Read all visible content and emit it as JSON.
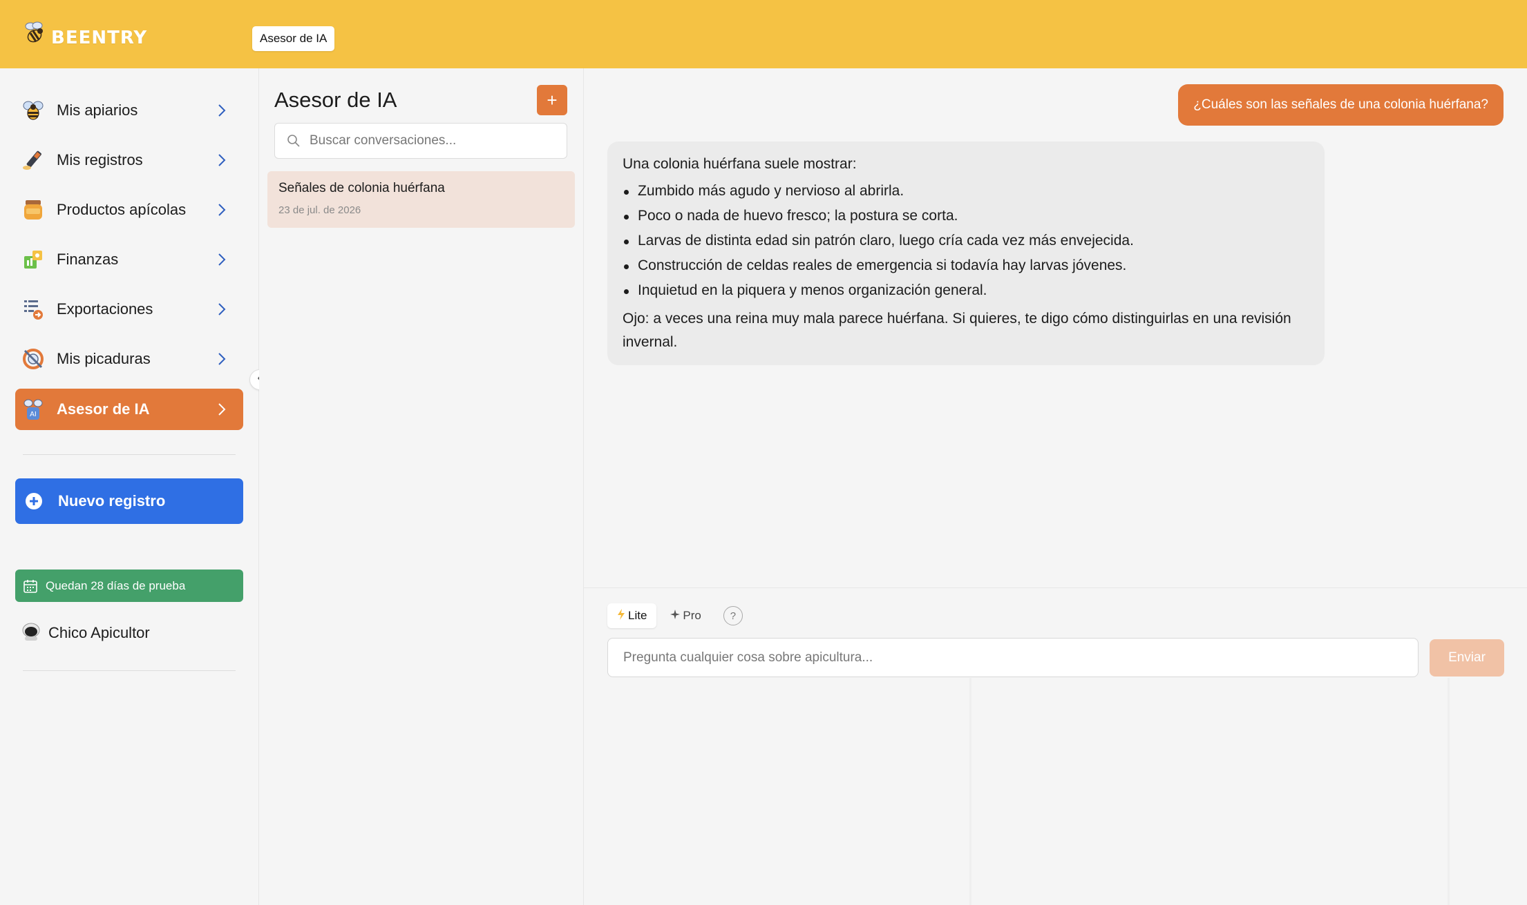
{
  "app": {
    "brand": "BEENTRY",
    "top_tab": "Asesor de IA"
  },
  "sidebar": {
    "items": [
      {
        "label": "Mis apiarios",
        "icon": "bee-icon"
      },
      {
        "label": "Mis registros",
        "icon": "pen-icon"
      },
      {
        "label": "Productos apícolas",
        "icon": "honey-jar-icon"
      },
      {
        "label": "Finanzas",
        "icon": "finance-icon"
      },
      {
        "label": "Exportaciones",
        "icon": "export-icon"
      },
      {
        "label": "Mis picaduras",
        "icon": "sting-icon"
      },
      {
        "label": "Asesor de IA",
        "icon": "ai-advisor-icon",
        "active": true
      }
    ],
    "new_record": "Nuevo registro",
    "trial": "Quedan 28 días de prueba",
    "user": "Chico Apicultor"
  },
  "conversations": {
    "title": "Asesor de IA",
    "add_label": "+",
    "search_placeholder": "Buscar conversaciones...",
    "items": [
      {
        "title": "Señales de colonia huérfana",
        "date": "23 de jul. de 2026"
      }
    ]
  },
  "chat": {
    "user_message": "¿Cuáles son las señales de una colonia huérfana?",
    "bot_intro": "Una colonia huérfana suele mostrar:",
    "bot_points": [
      "Zumbido más agudo y nervioso al abrirla.",
      "Poco o nada de huevo fresco; la postura se corta.",
      "Larvas de distinta edad sin patrón claro, luego cría cada vez más envejecida.",
      "Construcción de celdas reales de emergencia si todavía hay larvas jóvenes.",
      "Inquietud en la piquera y menos organización general."
    ],
    "bot_outro": "Ojo: a veces una reina muy mala parece huérfana. Si quieres, te digo cómo distinguirlas en una revisión invernal."
  },
  "composer": {
    "mode_lite": "Lite",
    "mode_pro": "Pro",
    "help": "?",
    "placeholder": "Pregunta cualquier cosa sobre apicultura...",
    "send": "Enviar"
  },
  "colors": {
    "topbar": "#f5c244",
    "accent": "#e2793a",
    "primary_blue": "#2f6fe4",
    "trial_green": "#44a06a"
  }
}
